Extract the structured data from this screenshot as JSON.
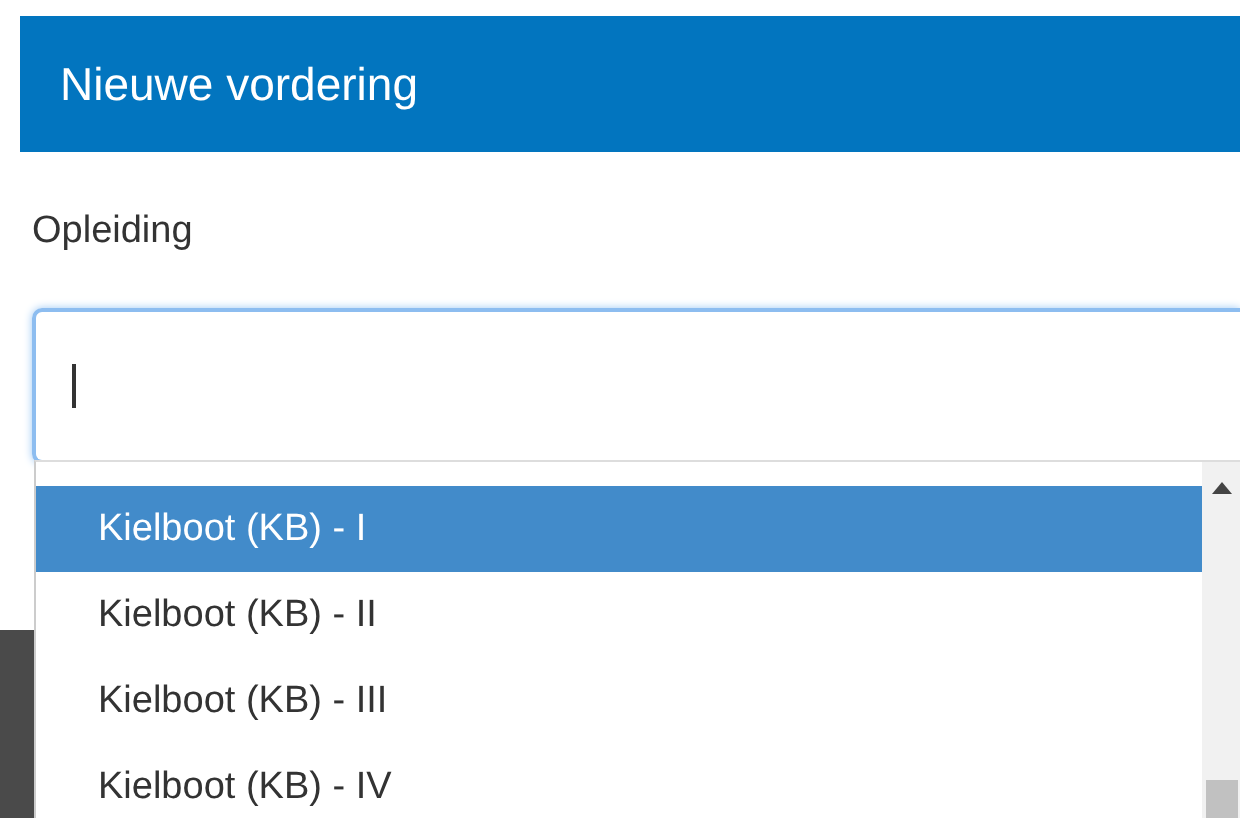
{
  "dialog": {
    "title": "Nieuwe vordering"
  },
  "field": {
    "label": "Opleiding",
    "focused": true
  },
  "dropdown": {
    "options": [
      {
        "label": "Kielboot (KB) - I",
        "selected": true
      },
      {
        "label": "Kielboot (KB) - II",
        "selected": false
      },
      {
        "label": "Kielboot (KB) - III",
        "selected": false
      },
      {
        "label": "Kielboot (KB) - IV",
        "selected": false
      }
    ]
  }
}
